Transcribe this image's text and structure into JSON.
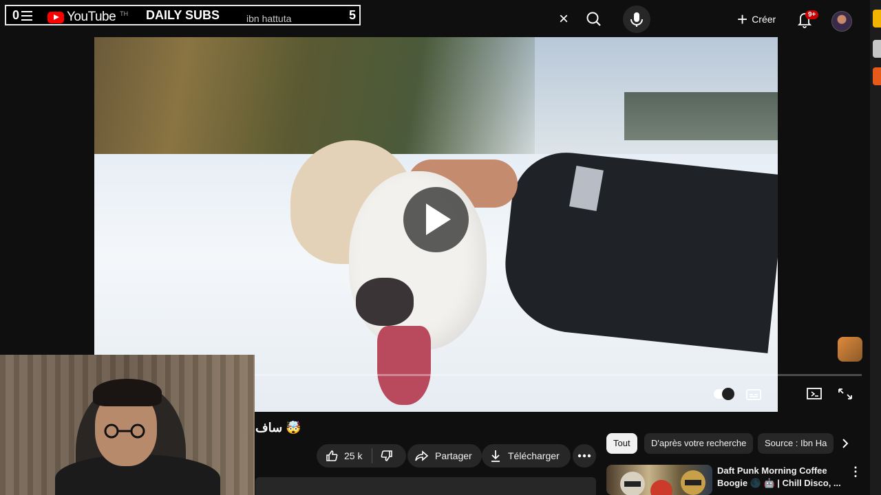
{
  "overlay": {
    "count_left": "0",
    "title": "DAILY SUBS",
    "search_text": "ibn hattuta",
    "count_right": "5"
  },
  "header": {
    "logo_text": "YouTube",
    "country_code": "TH",
    "create_label": "Créer",
    "notifications_badge": "9+"
  },
  "video": {
    "title_fragment": "ساف 🤯"
  },
  "actions": {
    "like_count": "25 k",
    "share_label": "Partager",
    "download_label": "Télécharger"
  },
  "chips": [
    "Tout",
    "D'après votre recherche",
    "Source : Ibn Ha"
  ],
  "recommendation": {
    "title": "Daft Punk Morning Coffee Boogie 🌑 🤖 | Chill Disco, ..."
  },
  "colors": {
    "brand_red": "#ff0000",
    "background": "#0f0f0f",
    "chip_bg": "#272727",
    "badge_red": "#cc0000"
  }
}
